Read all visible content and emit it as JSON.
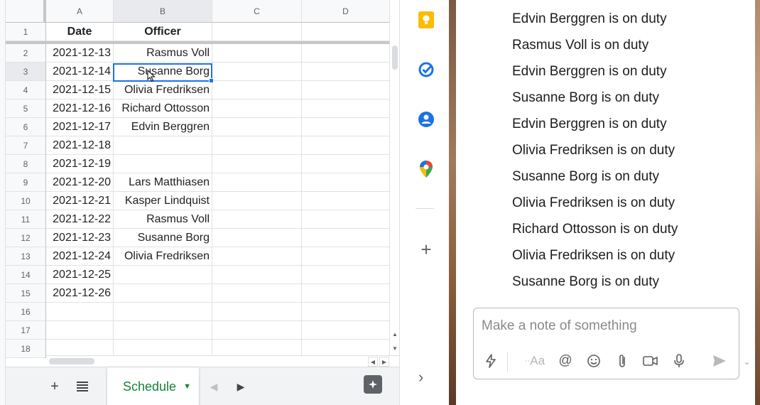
{
  "spreadsheet": {
    "columns": [
      "A",
      "B",
      "C",
      "D"
    ],
    "header_row": {
      "row": "1",
      "date": "Date",
      "officer": "Officer"
    },
    "rows": [
      {
        "row": "2",
        "date": "2021-12-13",
        "officer": "Rasmus Voll"
      },
      {
        "row": "3",
        "date": "2021-12-14",
        "officer": "Susanne Borg"
      },
      {
        "row": "4",
        "date": "2021-12-15",
        "officer": "Olivia Fredriksen"
      },
      {
        "row": "5",
        "date": "2021-12-16",
        "officer": "Richard Ottosson"
      },
      {
        "row": "6",
        "date": "2021-12-17",
        "officer": "Edvin Berggren"
      },
      {
        "row": "7",
        "date": "2021-12-18",
        "officer": ""
      },
      {
        "row": "8",
        "date": "2021-12-19",
        "officer": ""
      },
      {
        "row": "9",
        "date": "2021-12-20",
        "officer": "Lars Matthiasen"
      },
      {
        "row": "10",
        "date": "2021-12-21",
        "officer": "Kasper Lindquist"
      },
      {
        "row": "11",
        "date": "2021-12-22",
        "officer": "Rasmus Voll"
      },
      {
        "row": "12",
        "date": "2021-12-23",
        "officer": "Susanne Borg"
      },
      {
        "row": "13",
        "date": "2021-12-24",
        "officer": "Olivia Fredriksen"
      },
      {
        "row": "14",
        "date": "2021-12-25",
        "officer": ""
      },
      {
        "row": "15",
        "date": "2021-12-26",
        "officer": ""
      },
      {
        "row": "16",
        "date": "",
        "officer": ""
      },
      {
        "row": "17",
        "date": "",
        "officer": ""
      },
      {
        "row": "18",
        "date": "",
        "officer": ""
      }
    ],
    "selected_cell": "B3",
    "sheet_tab": "Schedule"
  },
  "side_panel": {
    "icons": [
      "keep-icon",
      "tasks-icon",
      "contacts-icon",
      "maps-icon",
      "add-icon",
      "expand-icon"
    ]
  },
  "chat": {
    "messages": [
      "Edvin Berggren is on duty",
      "Rasmus Voll is on duty",
      "Edvin Berggren is on duty",
      "Susanne Borg is on duty",
      "Edvin Berggren is on duty",
      "Olivia Fredriksen is on duty",
      "Susanne Borg is on duty",
      "Olivia Fredriksen is on duty",
      "Richard Ottosson is on duty",
      "Olivia Fredriksen is on duty",
      "Susanne Borg is on duty"
    ],
    "composer": {
      "placeholder": "Make a note of something",
      "format_label": "Aa"
    }
  },
  "colors": {
    "accent_blue": "#1a73e8",
    "sheet_tab_green": "#188038",
    "keep_yellow": "#fbbc04"
  }
}
